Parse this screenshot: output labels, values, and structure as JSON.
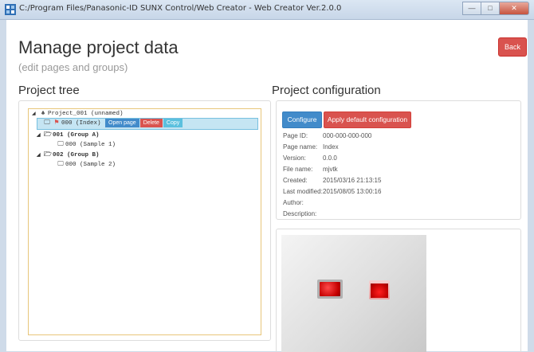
{
  "window": {
    "title": "C:/Program Files/Panasonic-ID SUNX Control/Web Creator - Web Creator Ver.2.0.0",
    "minimize": "—",
    "maximize": "□",
    "close": "✕"
  },
  "header": {
    "title": "Manage project data",
    "subtitle": "(edit pages and groups)",
    "back_label": "Back"
  },
  "tree_section": {
    "title": "Project tree",
    "root": "Project_001 (unnamed)",
    "nodes": [
      {
        "label": "000 (Index)",
        "selected": true,
        "icon": "monitor-icon",
        "flag": true
      },
      {
        "label": "001 (Group A)",
        "bold": true,
        "icon": "folder-icon"
      },
      {
        "label": "000 (Sample 1)",
        "icon": "monitor-icon"
      },
      {
        "label": "002 (Group B)",
        "bold": true,
        "icon": "folder-icon"
      },
      {
        "label": "000 (Sample 2)",
        "icon": "monitor-icon"
      }
    ],
    "actions": {
      "open": "Open page",
      "delete": "Delete",
      "copy": "Copy"
    }
  },
  "config_section": {
    "title": "Project configuration",
    "configure_label": "Configure",
    "apply_default_label": "Apply default configuration",
    "fields": [
      {
        "label": "Page ID:",
        "value": "000-000-000-000"
      },
      {
        "label": "Page name:",
        "value": "Index"
      },
      {
        "label": "Version:",
        "value": "0.0.0"
      },
      {
        "label": "File name:",
        "value": "mjvtk"
      },
      {
        "label": "Created:",
        "value": "2015/03/16 21:13:15"
      },
      {
        "label": "Last modified:",
        "value": "2015/08/05 13:00:16"
      },
      {
        "label": "Author:",
        "value": ""
      },
      {
        "label": "Description:",
        "value": ""
      }
    ]
  },
  "colors": {
    "primary": "#428bca",
    "danger": "#d9534f",
    "info": "#5bc0de",
    "selection": "#c5e5f3"
  }
}
